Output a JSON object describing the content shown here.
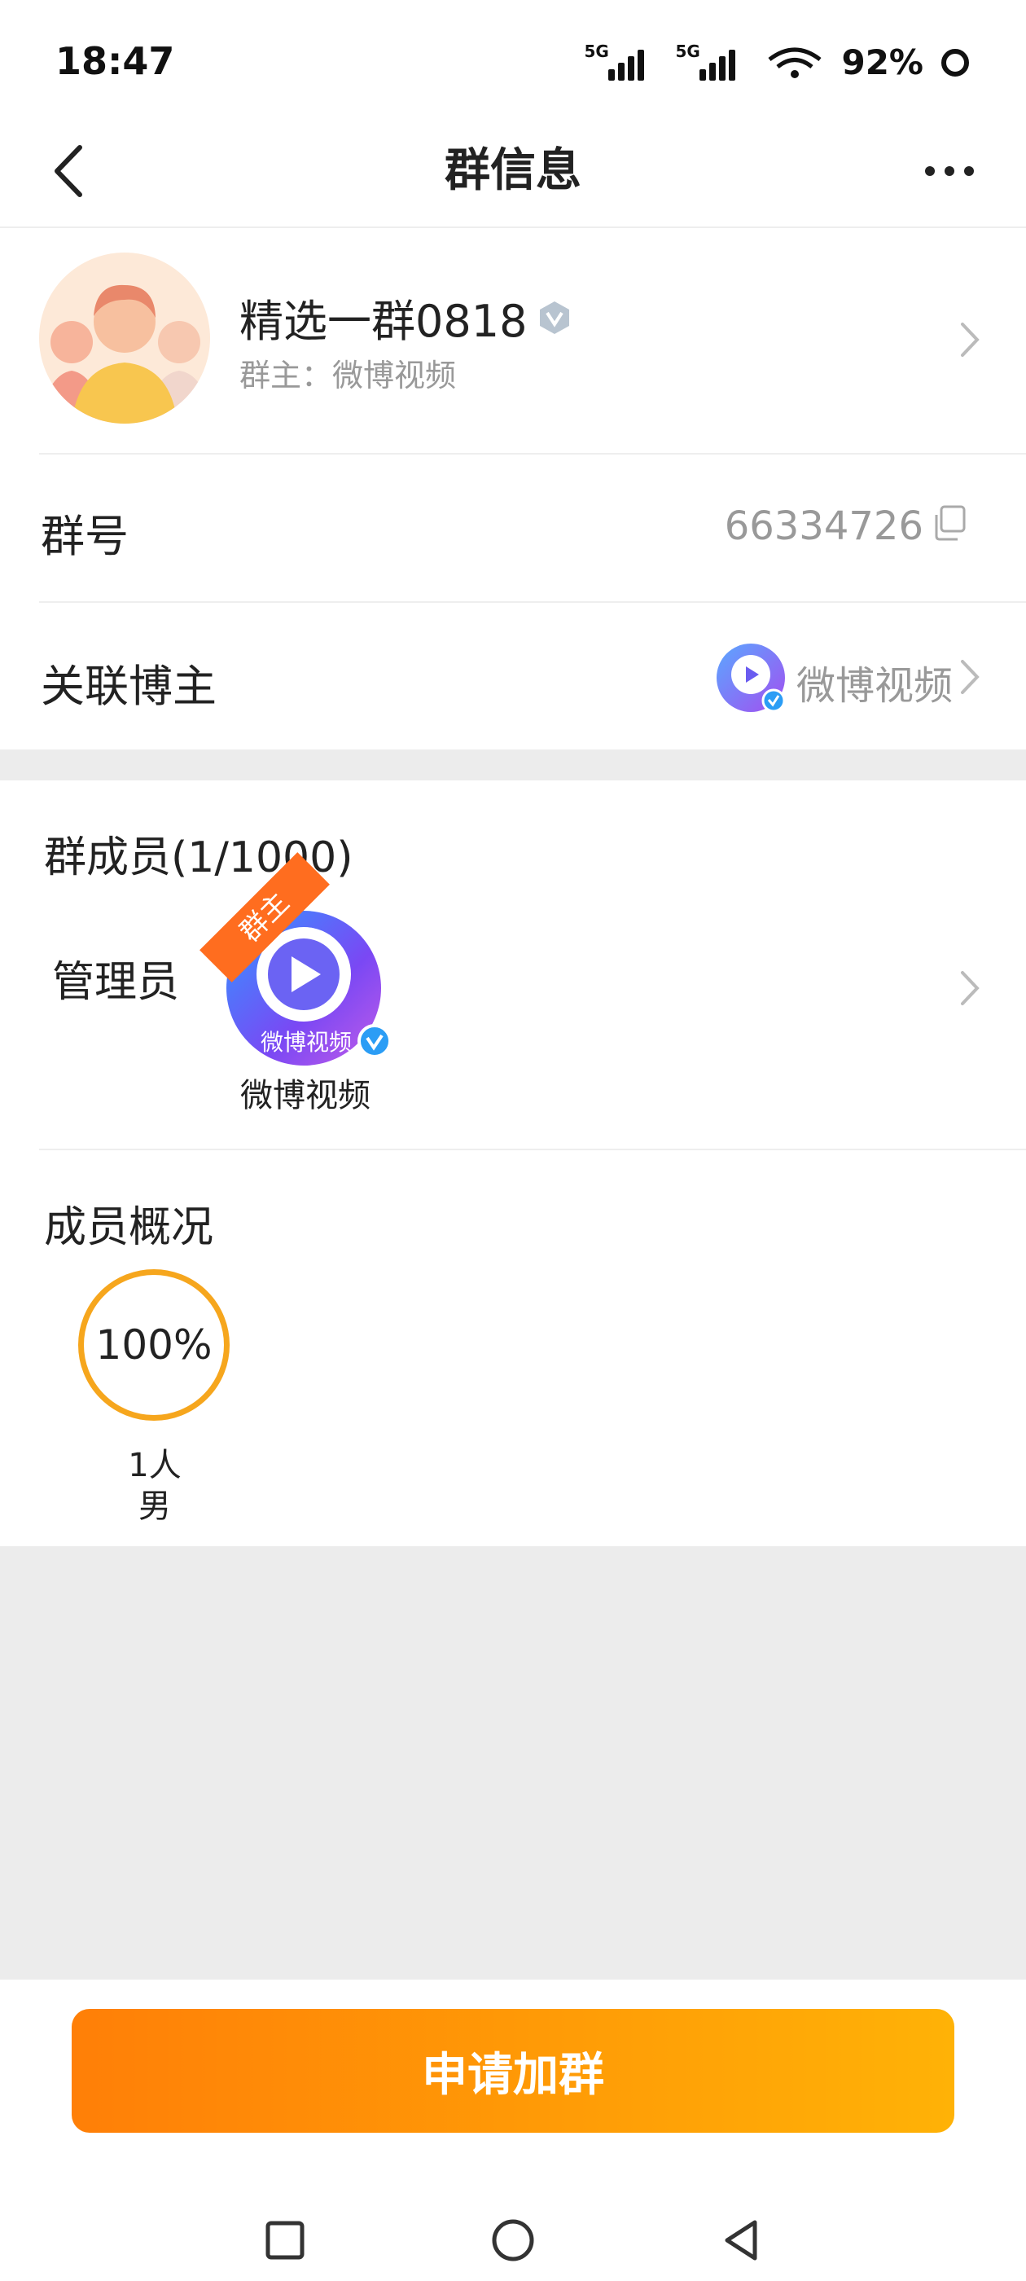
{
  "status_bar": {
    "time": "18:47",
    "network_1": "5G",
    "network_2": "5G",
    "battery": "92%"
  },
  "header": {
    "title": "群信息",
    "back_icon": "chevron-left-icon",
    "more_icon": "more-dots-icon"
  },
  "group": {
    "name": "精选一群0818",
    "owner": "群主：微博视频",
    "number_label": "群号",
    "number": "66334726",
    "blogger_label": "关联博主",
    "blogger_name": "微博视频"
  },
  "members": {
    "title": "群成员(1/1000)",
    "admin_label": "管理员",
    "owner_tag": "群主",
    "admin_name": "微博视频",
    "avatar_text": "微博视频"
  },
  "overview": {
    "title": "成员概况",
    "percent": "100%",
    "count": "1人",
    "gender": "男",
    "ring_color": "#f6a61d"
  },
  "actions": {
    "join": "申请加群",
    "accent_start": "#ff7f07",
    "accent_end": "#ffb206"
  }
}
